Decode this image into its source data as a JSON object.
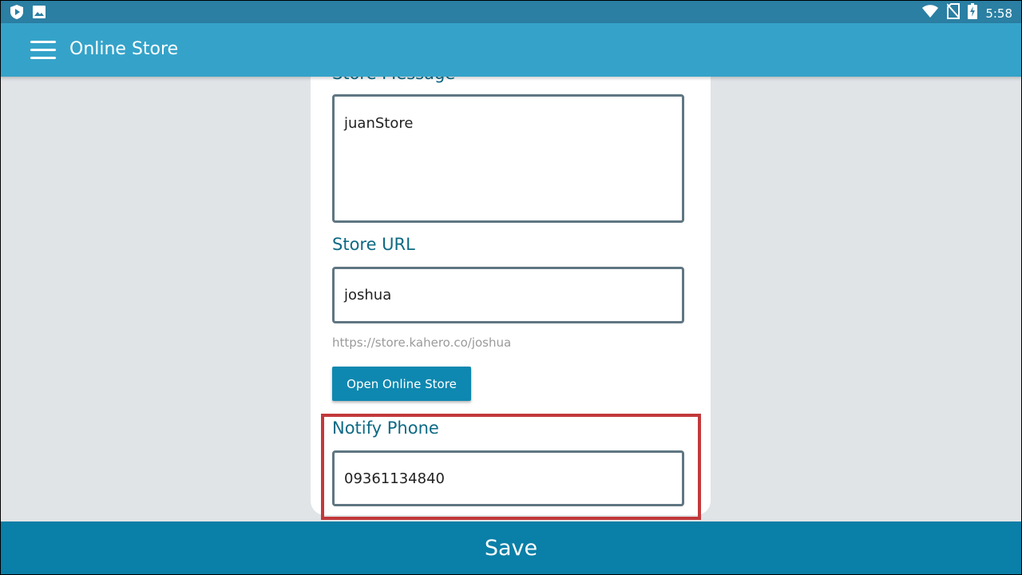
{
  "status_bar": {
    "time": "5:58",
    "left_icons": [
      "shield-play-icon",
      "image-icon"
    ],
    "right_icons": [
      "wifi-icon",
      "no-sim-icon",
      "battery-charging-icon"
    ]
  },
  "app_bar": {
    "title": "Online Store",
    "menu_icon": "menu-icon"
  },
  "form": {
    "store_message": {
      "label": "Store Message",
      "value": "juanStore"
    },
    "store_url": {
      "label": "Store URL",
      "value": "joshua",
      "hint": "https://store.kahero.co/joshua"
    },
    "open_store_button": "Open Online Store",
    "notify_phone": {
      "label": "Notify Phone",
      "value": "09361134840"
    }
  },
  "footer": {
    "save_label": "Save"
  },
  "colors": {
    "status_bar": "#2a7fa3",
    "app_bar": "#35a3c9",
    "label": "#0e6a84",
    "button": "#0e88b0",
    "save_bar": "#0a7fa7",
    "highlight": "#c2393b",
    "background": "#e0e4e7"
  }
}
